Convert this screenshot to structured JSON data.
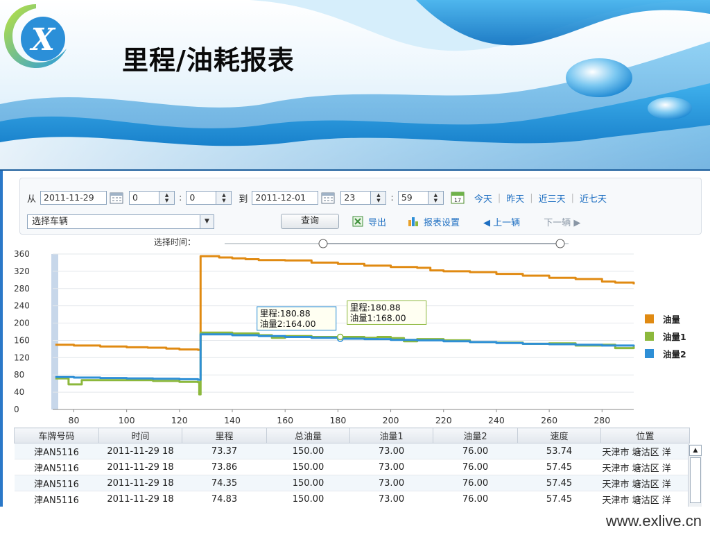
{
  "header": {
    "title": "里程/油耗报表"
  },
  "toolbar": {
    "from_label": "从",
    "from_date": "2011-11-29",
    "from_hour": "0",
    "from_minute": "0",
    "to_label": "到",
    "to_date": "2011-12-01",
    "to_hour": "23",
    "to_minute": "59",
    "colon": ":",
    "quick_links": [
      "今天",
      "昨天",
      "近三天",
      "近七天"
    ],
    "vehicle_select": "选择车辆",
    "query_button": "查询",
    "export_label": "导出",
    "report_settings_label": "报表设置",
    "prev_vehicle": "◀ 上一辆",
    "next_vehicle": "下一辆 ▶",
    "calendar_day": "17"
  },
  "slider": {
    "label": "选择时间："
  },
  "chart_data": {
    "type": "line",
    "xlim": [
      72,
      292
    ],
    "ylim": [
      0,
      360
    ],
    "x_ticks": [
      80,
      100,
      120,
      140,
      160,
      180,
      200,
      220,
      240,
      260,
      280
    ],
    "y_ticks": [
      0,
      40,
      80,
      120,
      160,
      200,
      240,
      280,
      320,
      360
    ],
    "grid": true,
    "legend_position": "right",
    "series": [
      {
        "name": "油量",
        "color": "#e08a12",
        "points": [
          [
            73,
            150
          ],
          [
            80,
            148
          ],
          [
            90,
            146
          ],
          [
            100,
            144
          ],
          [
            108,
            143
          ],
          [
            115,
            141
          ],
          [
            120,
            139
          ],
          [
            127,
            138
          ],
          [
            128,
            355
          ],
          [
            132,
            355
          ],
          [
            135,
            352
          ],
          [
            140,
            350
          ],
          [
            145,
            348
          ],
          [
            150,
            346
          ],
          [
            160,
            345
          ],
          [
            170,
            340
          ],
          [
            175,
            340
          ],
          [
            180,
            337
          ],
          [
            190,
            333
          ],
          [
            200,
            330
          ],
          [
            210,
            328
          ],
          [
            215,
            322
          ],
          [
            220,
            320
          ],
          [
            230,
            318
          ],
          [
            240,
            314
          ],
          [
            250,
            310
          ],
          [
            260,
            305
          ],
          [
            270,
            302
          ],
          [
            280,
            296
          ],
          [
            285,
            294
          ],
          [
            292,
            290
          ]
        ]
      },
      {
        "name": "油量1",
        "color": "#8cb83c",
        "points": [
          [
            73,
            72
          ],
          [
            77,
            72
          ],
          [
            78,
            58
          ],
          [
            82,
            58
          ],
          [
            83,
            68
          ],
          [
            90,
            68
          ],
          [
            100,
            68
          ],
          [
            110,
            66
          ],
          [
            120,
            64
          ],
          [
            127,
            63
          ],
          [
            127.5,
            35
          ],
          [
            128,
            178
          ],
          [
            135,
            178
          ],
          [
            140,
            176
          ],
          [
            150,
            172
          ],
          [
            155,
            166
          ],
          [
            160,
            170
          ],
          [
            170,
            168
          ],
          [
            180,
            168
          ],
          [
            190,
            166
          ],
          [
            195,
            168
          ],
          [
            200,
            165
          ],
          [
            205,
            158
          ],
          [
            210,
            163
          ],
          [
            220,
            160
          ],
          [
            230,
            156
          ],
          [
            240,
            155
          ],
          [
            250,
            152
          ],
          [
            260,
            153
          ],
          [
            270,
            148
          ],
          [
            280,
            150
          ],
          [
            285,
            142
          ],
          [
            292,
            146
          ]
        ]
      },
      {
        "name": "油量2",
        "color": "#2e8fd6",
        "points": [
          [
            73,
            75
          ],
          [
            80,
            74
          ],
          [
            90,
            73
          ],
          [
            100,
            72
          ],
          [
            110,
            71
          ],
          [
            120,
            70
          ],
          [
            127,
            69
          ],
          [
            128,
            174
          ],
          [
            135,
            174
          ],
          [
            140,
            172
          ],
          [
            150,
            170
          ],
          [
            160,
            168
          ],
          [
            170,
            166
          ],
          [
            180,
            164
          ],
          [
            190,
            163
          ],
          [
            200,
            161
          ],
          [
            210,
            160
          ],
          [
            220,
            158
          ],
          [
            230,
            156
          ],
          [
            240,
            154
          ],
          [
            250,
            152
          ],
          [
            260,
            151
          ],
          [
            270,
            150
          ],
          [
            280,
            148
          ],
          [
            292,
            146
          ]
        ]
      }
    ],
    "tooltips": [
      {
        "series": "油量2",
        "x": 180.88,
        "y": 164.0,
        "lines": [
          "里程:180.88",
          "油量2:164.00"
        ]
      },
      {
        "series": "油量1",
        "x": 180.88,
        "y": 168.0,
        "lines": [
          "里程:180.88",
          "油量1:168.00"
        ]
      }
    ]
  },
  "table": {
    "columns": [
      "车牌号码",
      "时间",
      "里程",
      "总油量",
      "油量1",
      "油量2",
      "速度",
      "位置"
    ],
    "rows": [
      [
        "津AN5116",
        "2011-11-29 18",
        "73.37",
        "150.00",
        "73.00",
        "76.00",
        "53.74",
        "天津市 塘沽区 洋"
      ],
      [
        "津AN5116",
        "2011-11-29 18",
        "73.86",
        "150.00",
        "73.00",
        "76.00",
        "57.45",
        "天津市 塘沽区 洋"
      ],
      [
        "津AN5116",
        "2011-11-29 18",
        "74.35",
        "150.00",
        "73.00",
        "76.00",
        "57.45",
        "天津市 塘沽区 洋"
      ],
      [
        "津AN5116",
        "2011-11-29 18",
        "74.83",
        "150.00",
        "73.00",
        "76.00",
        "57.45",
        "天津市 塘沽区 洋"
      ]
    ]
  },
  "footer": {
    "url": "www.exlive.cn"
  }
}
